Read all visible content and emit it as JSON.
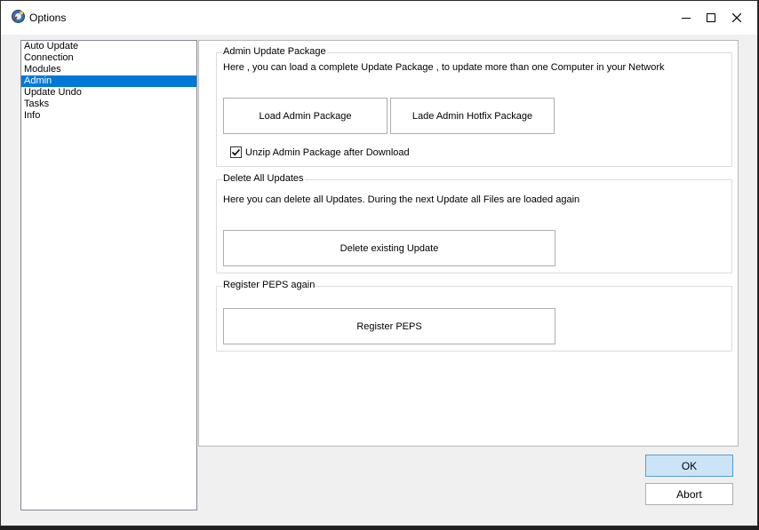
{
  "window": {
    "title": "Options",
    "icon": "options-app-icon",
    "controls": {
      "minimize": "minimize-icon",
      "maximize": "maximize-icon",
      "close": "close-icon"
    }
  },
  "sidebar": {
    "items": [
      {
        "label": "Auto Update"
      },
      {
        "label": "Connection"
      },
      {
        "label": "Modules"
      },
      {
        "label": "Admin",
        "selected": true
      },
      {
        "label": "Update Undo"
      },
      {
        "label": "Tasks"
      },
      {
        "label": "Info"
      }
    ]
  },
  "admin_update_package": {
    "title": "Admin Update Package",
    "description": "Here , you can load a complete Update Package , to update more than one Computer in your Network",
    "load_button": "Load Admin Package",
    "hotfix_button": "Lade Admin Hotfix Package",
    "unzip_checkbox": {
      "label": "Unzip Admin Package after Download",
      "checked": true
    }
  },
  "delete_updates": {
    "title": "Delete All Updates",
    "description": "Here you can delete all Updates. During the next Update all Files are loaded again",
    "delete_button": "Delete existing Update"
  },
  "register_peps": {
    "title": "Register PEPS again",
    "register_button": "Register PEPS"
  },
  "footer": {
    "ok_label": "OK",
    "abort_label": "Abort"
  },
  "colors": {
    "selection": "#0078d7",
    "ok_button_bg": "#cce4f7",
    "ok_button_border": "#5a9bd6"
  }
}
